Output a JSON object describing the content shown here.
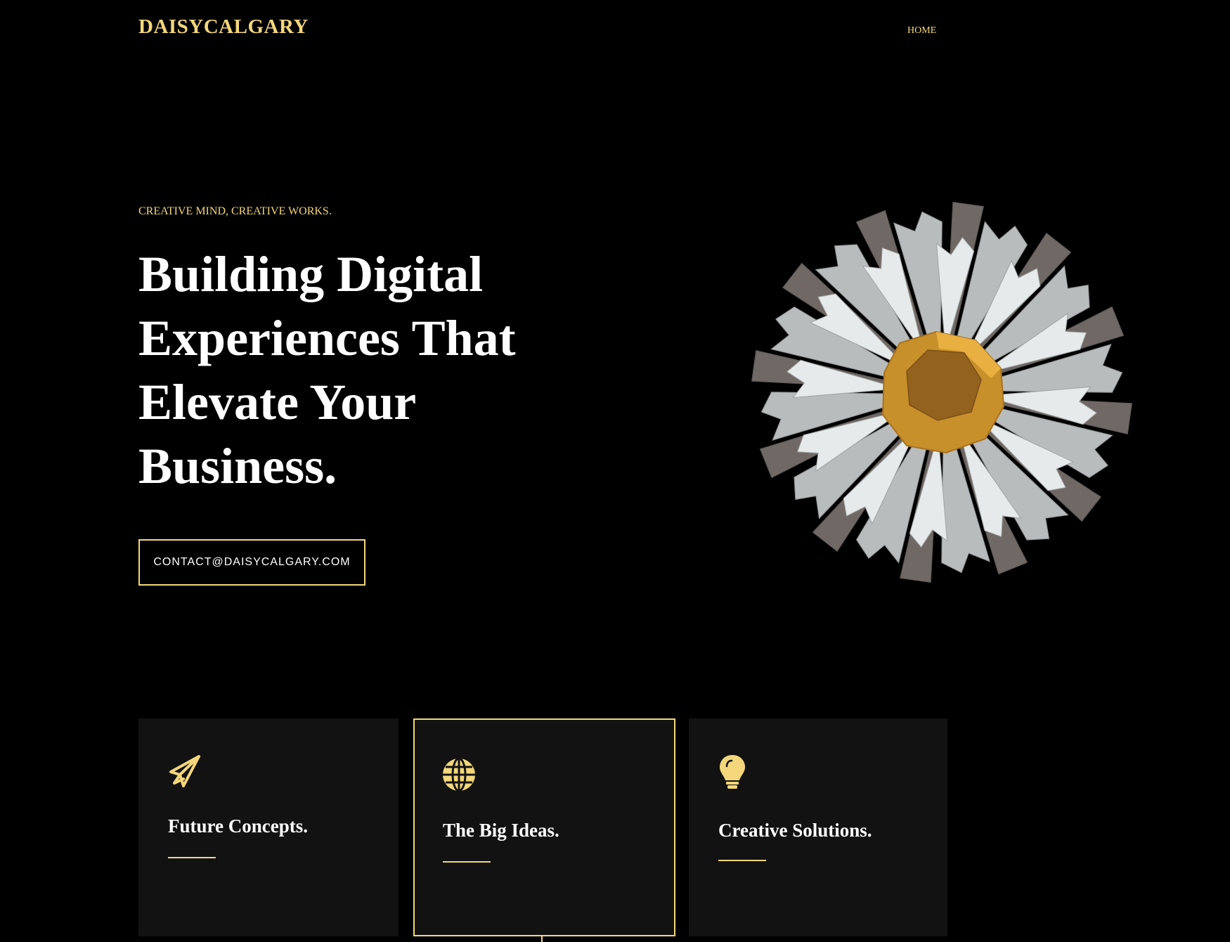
{
  "header": {
    "logo": "DAISYCALGARY",
    "nav": [
      {
        "label": "HOME"
      }
    ]
  },
  "hero": {
    "eyebrow": "CREATIVE MIND, CREATIVE WORKS.",
    "title": "Building Digital Experiences That Elevate Your Business.",
    "cta_label": "CONTACT@DAISYCALGARY.COM"
  },
  "features": [
    {
      "title": "Future Concepts.",
      "icon": "paper-plane-icon"
    },
    {
      "title": "The Big Ideas.",
      "icon": "globe-icon"
    },
    {
      "title": "Creative Solutions.",
      "icon": "lightbulb-icon"
    }
  ],
  "colors": {
    "accent": "#f3d77a",
    "background": "#000000",
    "card_background": "#121212",
    "text": "#ffffff"
  }
}
